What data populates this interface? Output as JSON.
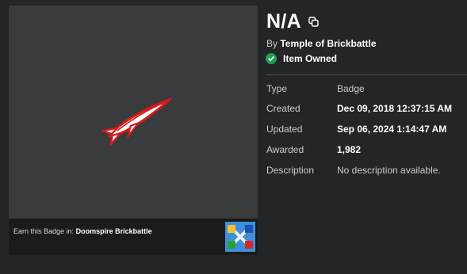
{
  "item": {
    "title": "N/A",
    "by_prefix": "By",
    "creator": "Temple of Brickbattle",
    "owned_label": "Item Owned"
  },
  "earn": {
    "prefix": "Earn this Badge in:",
    "place_name": "Doomspire Brickbattle"
  },
  "details": {
    "type_key": "Type",
    "type_value": "Badge",
    "created_key": "Created",
    "created_value": "Dec 09, 2018 12:37:15 AM",
    "updated_key": "Updated",
    "updated_value": "Sep 06, 2024 1:14:47 AM",
    "awarded_key": "Awarded",
    "awarded_value": "1,982",
    "description_key": "Description",
    "description_value": "No description available."
  },
  "icons": {
    "copy": "copy-icon",
    "owned": "checkmark-icon",
    "badge": "rocket-badge-icon",
    "place": "doomspire-thumbnail"
  },
  "colors": {
    "background": "#232527",
    "thumbnail_bg": "#393b3d",
    "owned_green": "#1e9e52",
    "rocket_red": "#d11a1a"
  }
}
